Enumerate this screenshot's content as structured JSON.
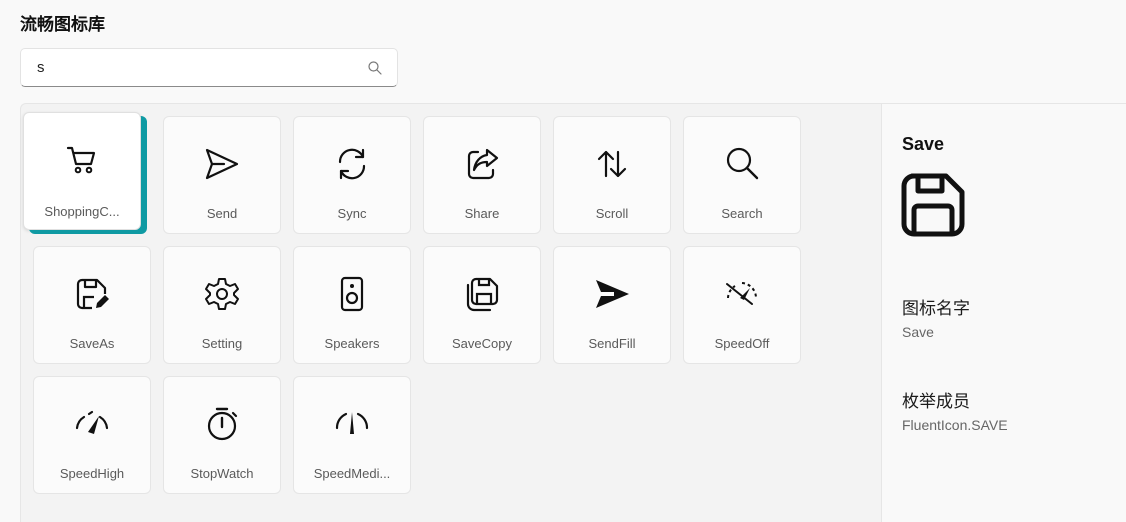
{
  "page": {
    "title": "流畅图标库"
  },
  "search": {
    "value": "s",
    "icon": "search-icon"
  },
  "colors": {
    "accent": "#0f9aa3",
    "panel": "#f3f3f3",
    "card": "#fbfbfb"
  },
  "icons": [
    {
      "label": "ShoppingC...",
      "icon": "shopping-cart-icon",
      "selected": true
    },
    {
      "label": "Send",
      "icon": "send-icon"
    },
    {
      "label": "Sync",
      "icon": "sync-icon"
    },
    {
      "label": "Share",
      "icon": "share-icon"
    },
    {
      "label": "Scroll",
      "icon": "scroll-icon"
    },
    {
      "label": "Search",
      "icon": "search-icon"
    },
    {
      "label": "SaveAs",
      "icon": "save-as-icon"
    },
    {
      "label": "Setting",
      "icon": "setting-icon"
    },
    {
      "label": "Speakers",
      "icon": "speakers-icon"
    },
    {
      "label": "SaveCopy",
      "icon": "save-copy-icon"
    },
    {
      "label": "SendFill",
      "icon": "send-fill-icon"
    },
    {
      "label": "SpeedOff",
      "icon": "speed-off-icon"
    },
    {
      "label": "SpeedHigh",
      "icon": "speed-high-icon"
    },
    {
      "label": "StopWatch",
      "icon": "stopwatch-icon"
    },
    {
      "label": "SpeedMedi...",
      "icon": "speed-medium-icon"
    }
  ],
  "detail": {
    "title": "Save",
    "icon": "save-icon",
    "name_heading": "图标名字",
    "name_value": "Save",
    "enum_heading": "枚举成员",
    "enum_value": "FluentIcon.SAVE"
  }
}
